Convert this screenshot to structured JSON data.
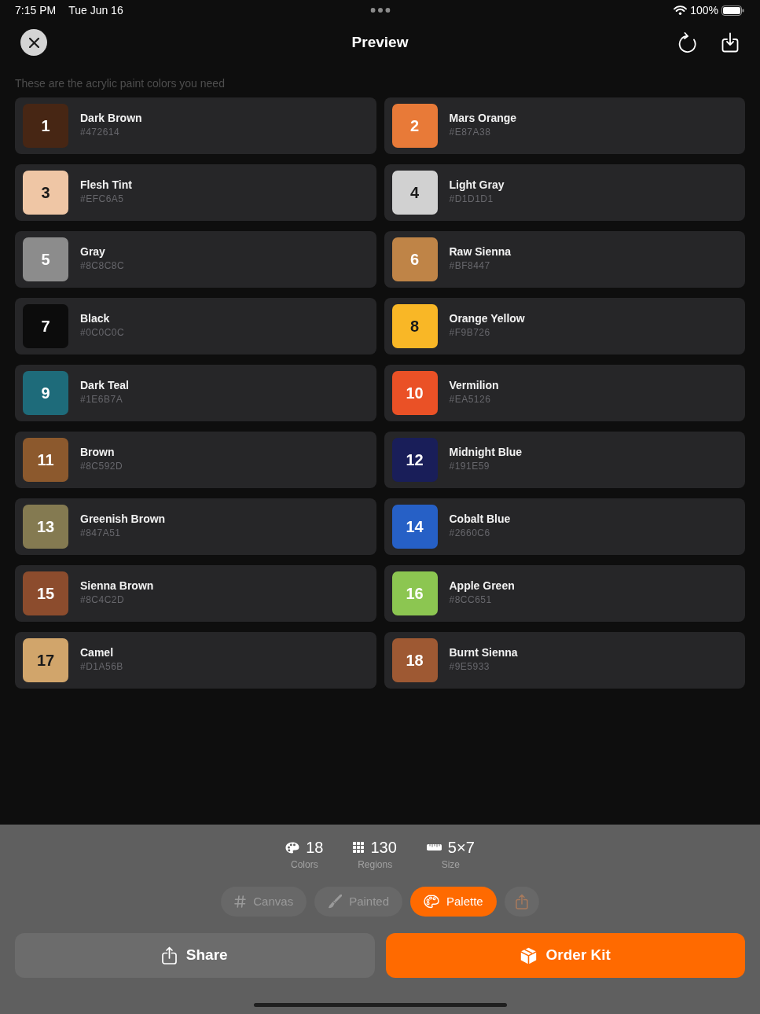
{
  "status_bar": {
    "time": "7:15 PM",
    "date": "Tue Jun 16",
    "battery": "100%"
  },
  "header": {
    "title": "Preview"
  },
  "subtitle": "These are the acrylic paint colors you need",
  "paints": [
    {
      "number": "1",
      "name": "Dark Brown",
      "hex": "#472614",
      "color": "#472614"
    },
    {
      "number": "2",
      "name": "Mars Orange",
      "hex": "#E87A38",
      "color": "#e87a38"
    },
    {
      "number": "3",
      "name": "Flesh Tint",
      "hex": "#EFC6A5",
      "color": "#efc6a5"
    },
    {
      "number": "4",
      "name": "Light Gray",
      "hex": "#D1D1D1",
      "color": "#d1d1d1"
    },
    {
      "number": "5",
      "name": "Gray",
      "hex": "#8C8C8C",
      "color": "#8c8c8c"
    },
    {
      "number": "6",
      "name": "Raw Sienna",
      "hex": "#BF8447",
      "color": "#bf8447"
    },
    {
      "number": "7",
      "name": "Black",
      "hex": "#0C0C0C",
      "color": "#0c0c0c"
    },
    {
      "number": "8",
      "name": "Orange Yellow",
      "hex": "#F9B726",
      "color": "#f9b726"
    },
    {
      "number": "9",
      "name": "Dark Teal",
      "hex": "#1E6B7A",
      "color": "#1e6b7a"
    },
    {
      "number": "10",
      "name": "Vermilion",
      "hex": "#EA5126",
      "color": "#ea5126"
    },
    {
      "number": "11",
      "name": "Brown",
      "hex": "#8C592D",
      "color": "#8c592d"
    },
    {
      "number": "12",
      "name": "Midnight Blue",
      "hex": "#191E59",
      "color": "#191e59"
    },
    {
      "number": "13",
      "name": "Greenish Brown",
      "hex": "#847A51",
      "color": "#847a51"
    },
    {
      "number": "14",
      "name": "Cobalt Blue",
      "hex": "#2660C6",
      "color": "#2660c6"
    },
    {
      "number": "15",
      "name": "Sienna Brown",
      "hex": "#8C4C2D",
      "color": "#8c4c2d"
    },
    {
      "number": "16",
      "name": "Apple Green",
      "hex": "#8CC651",
      "color": "#8cc651"
    },
    {
      "number": "17",
      "name": "Camel",
      "hex": "#D1A56B",
      "color": "#d1a56b"
    },
    {
      "number": "18",
      "name": "Burnt Sienna",
      "hex": "#9E5933",
      "color": "#9e5933"
    }
  ],
  "stats": [
    {
      "kind": "colors",
      "value": "18",
      "label": "Colors"
    },
    {
      "kind": "regions",
      "value": "130",
      "label": "Regions"
    },
    {
      "kind": "size",
      "value": "5×7",
      "label": "Size"
    }
  ],
  "view_tabs": [
    {
      "kind": "canvas",
      "label": "Canvas",
      "selected": false
    },
    {
      "kind": "painted",
      "label": "Painted",
      "selected": false
    },
    {
      "kind": "palette",
      "label": "Palette",
      "selected": true
    }
  ],
  "export_button": {
    "disabled": true
  },
  "actions": [
    {
      "kind": "share",
      "label": "Share"
    },
    {
      "kind": "order",
      "label": "Order Kit"
    }
  ]
}
